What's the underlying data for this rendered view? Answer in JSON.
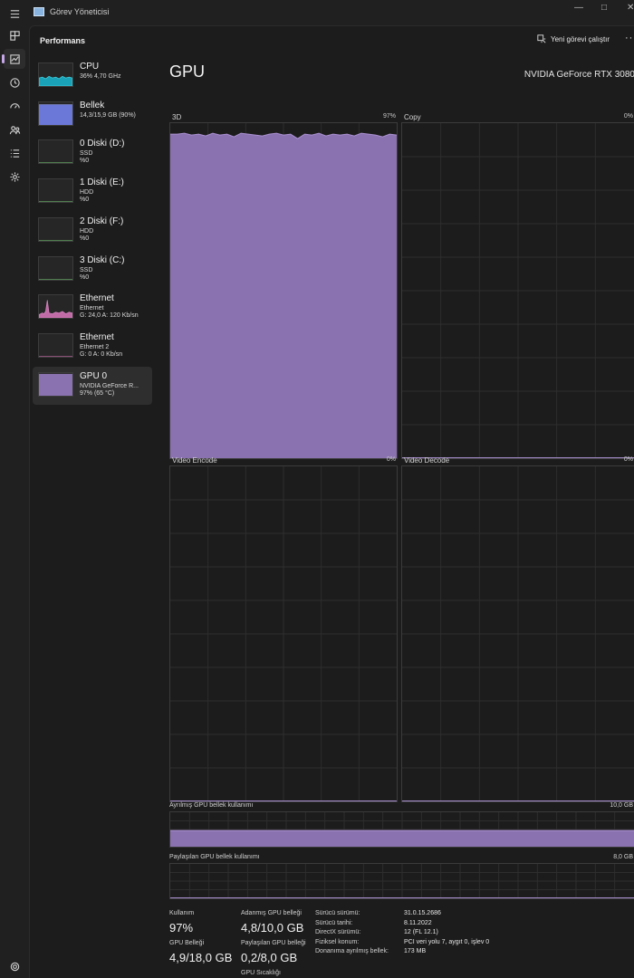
{
  "window": {
    "title": "Görev Yöneticisi"
  },
  "colors": {
    "gpu": "#8a72b0",
    "gpu_line": "#a98fd0",
    "cpu": "#1aa3b8",
    "memory": "#6b78d8",
    "ethernet": "#c06aa6",
    "disk": "#6ab46a"
  },
  "header": {
    "title": "Performans",
    "run_task_label": "Yeni görevi çalıştır",
    "more_label": "···"
  },
  "rail": [
    "menu-icon",
    "processes-icon",
    "performance-icon",
    "app-history-icon",
    "startup-icon",
    "users-icon",
    "details-icon",
    "services-icon",
    "settings-icon"
  ],
  "sidebar": [
    {
      "name": "CPU",
      "l1": "36% 4,70 GHz",
      "l2": "",
      "l3": "",
      "kind": "cpu"
    },
    {
      "name": "Bellek",
      "l1": "14,3/15,9 GB (90%)",
      "l2": "",
      "l3": "",
      "kind": "memory"
    },
    {
      "name": "0 Diski (D:)",
      "l1": "SSD",
      "l2": "%0",
      "l3": "",
      "kind": "disk"
    },
    {
      "name": "1 Diski (E:)",
      "l1": "HDD",
      "l2": "%0",
      "l3": "",
      "kind": "disk"
    },
    {
      "name": "2 Diski (F:)",
      "l1": "HDD",
      "l2": "%0",
      "l3": "",
      "kind": "disk"
    },
    {
      "name": "3 Diski (C:)",
      "l1": "SSD",
      "l2": "%0",
      "l3": "",
      "kind": "disk"
    },
    {
      "name": "Ethernet",
      "l1": "Ethernet",
      "l2": "G: 24,0 A: 120 Kb/sn",
      "l3": "",
      "kind": "ethernet"
    },
    {
      "name": "Ethernet",
      "l1": "Ethernet 2",
      "l2": "G: 0 A: 0 Kb/sn",
      "l3": "",
      "kind": "ethernet2"
    },
    {
      "name": "GPU 0",
      "l1": "NVIDIA GeForce R...",
      "l2": "97% (65 °C)",
      "l3": "",
      "kind": "gpu"
    }
  ],
  "gpu": {
    "heading": "GPU",
    "model": "NVIDIA GeForce RTX 3080",
    "engines": [
      {
        "label": "3D",
        "percent": "97%",
        "level": 0.97
      },
      {
        "label": "Copy",
        "percent": "0%",
        "level": 0
      },
      {
        "label": "Video Encode",
        "percent": "0%",
        "level": 0
      },
      {
        "label": "Video Decode",
        "percent": "0%",
        "level": 0
      }
    ],
    "dedicated_mem": {
      "label": "Ayrılmış GPU bellek kullanımı",
      "max": "10,0 GB",
      "level": 0.48
    },
    "shared_mem": {
      "label": "Paylaşılan GPU bellek kullanımı",
      "max": "8,0 GB",
      "level": 0.025
    },
    "stats": {
      "utilization_label": "Kullanım",
      "utilization": "97%",
      "gpu_memory_label": "GPU Belleği",
      "gpu_memory": "4,9/18,0 GB",
      "dedicated_label": "Adanmış GPU belleği",
      "dedicated": "4,8/10,0 GB",
      "shared_label": "Paylaşılan GPU belleği",
      "shared": "0,2/8,0 GB",
      "temp_label": "GPU Sıcaklığı",
      "temp": "65 °C"
    },
    "info": [
      {
        "k": "Sürücü sürümü:",
        "v": "31.0.15.2686"
      },
      {
        "k": "Sürücü tarihi:",
        "v": "8.11.2022"
      },
      {
        "k": "DirectX sürümü:",
        "v": "12 (FL 12.1)"
      },
      {
        "k": "Fiziksel konum:",
        "v": "PCI veri yolu 7, aygıt 0, işlev 0"
      },
      {
        "k": "Donanıma ayrılmış bellek:",
        "v": "173 MB"
      }
    ]
  }
}
